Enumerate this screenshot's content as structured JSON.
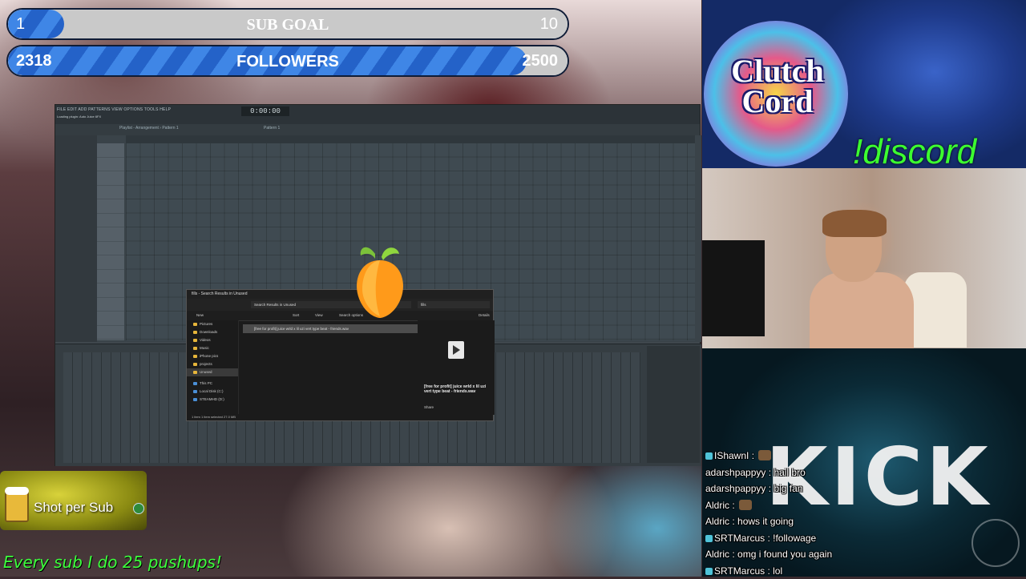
{
  "goals": {
    "sub": {
      "current": "1",
      "title": "SUB GOAL",
      "target": "10",
      "progress": 0.1
    },
    "followers": {
      "current": "2318",
      "title": "FOLLOWERS",
      "target": "2500",
      "progress": 0.927
    }
  },
  "daw": {
    "menu": "FILE EDIT ADD PATTERNS VIEW OPTIONS TOOLS HELP",
    "time": "0:00:00",
    "hint": "Loading plugin: Auto Juice 6FX",
    "playlist_title": "Playlist - Arrangement › Pattern 1",
    "pattern": "Pattern 1"
  },
  "explorer": {
    "title": "fills - Search Results in Unused",
    "address": "Search Results in Unused",
    "search": "fills",
    "toolbar": [
      "New",
      "Sort",
      "View",
      "Search options",
      "Details"
    ],
    "nav": [
      "Pictures",
      "Downloads",
      "Videos",
      "Music",
      "iPhone pics",
      "projects",
      "Unused",
      "This PC",
      "Local Disk (C:)",
      "STEAMHD (D:)"
    ],
    "file": "[free for profit] juice wrld x lil uzi vert type beat - friends.wav",
    "preview_name": "[free for profit] juice wrld x lil uzi vert type beat - friends.wav",
    "share": "Share",
    "status": "1 item   1 item selected  27.0 MB"
  },
  "overlay": {
    "discord_name": "Clutch Cord",
    "discord_cmd": "!discord",
    "kick": "KICK",
    "shot_label": "Shot per Sub",
    "pushups": "Every sub I do 25 pushups!"
  },
  "chat": [
    {
      "user": "IShawnI",
      "msg": "",
      "badge": true,
      "emote": true
    },
    {
      "user": "adarshpappyy",
      "msg": "hail bro",
      "badge": false,
      "emote": false
    },
    {
      "user": "adarshpappyy",
      "msg": "big fan",
      "badge": false,
      "emote": false
    },
    {
      "user": "Aldric",
      "msg": "",
      "badge": false,
      "emote": true
    },
    {
      "user": "Aldric",
      "msg": "hows it going",
      "badge": false,
      "emote": false
    },
    {
      "user": "SRTMarcus",
      "msg": "!followage",
      "badge": true,
      "emote": false
    },
    {
      "user": "Aldric",
      "msg": "omg i found you again",
      "badge": false,
      "emote": false
    },
    {
      "user": "SRTMarcus",
      "msg": "lol",
      "badge": true,
      "emote": false
    }
  ],
  "colors": {
    "goal_fill": "#2462c8",
    "pushups": "#3cff3c",
    "discord_cmd": "#3cff30"
  }
}
